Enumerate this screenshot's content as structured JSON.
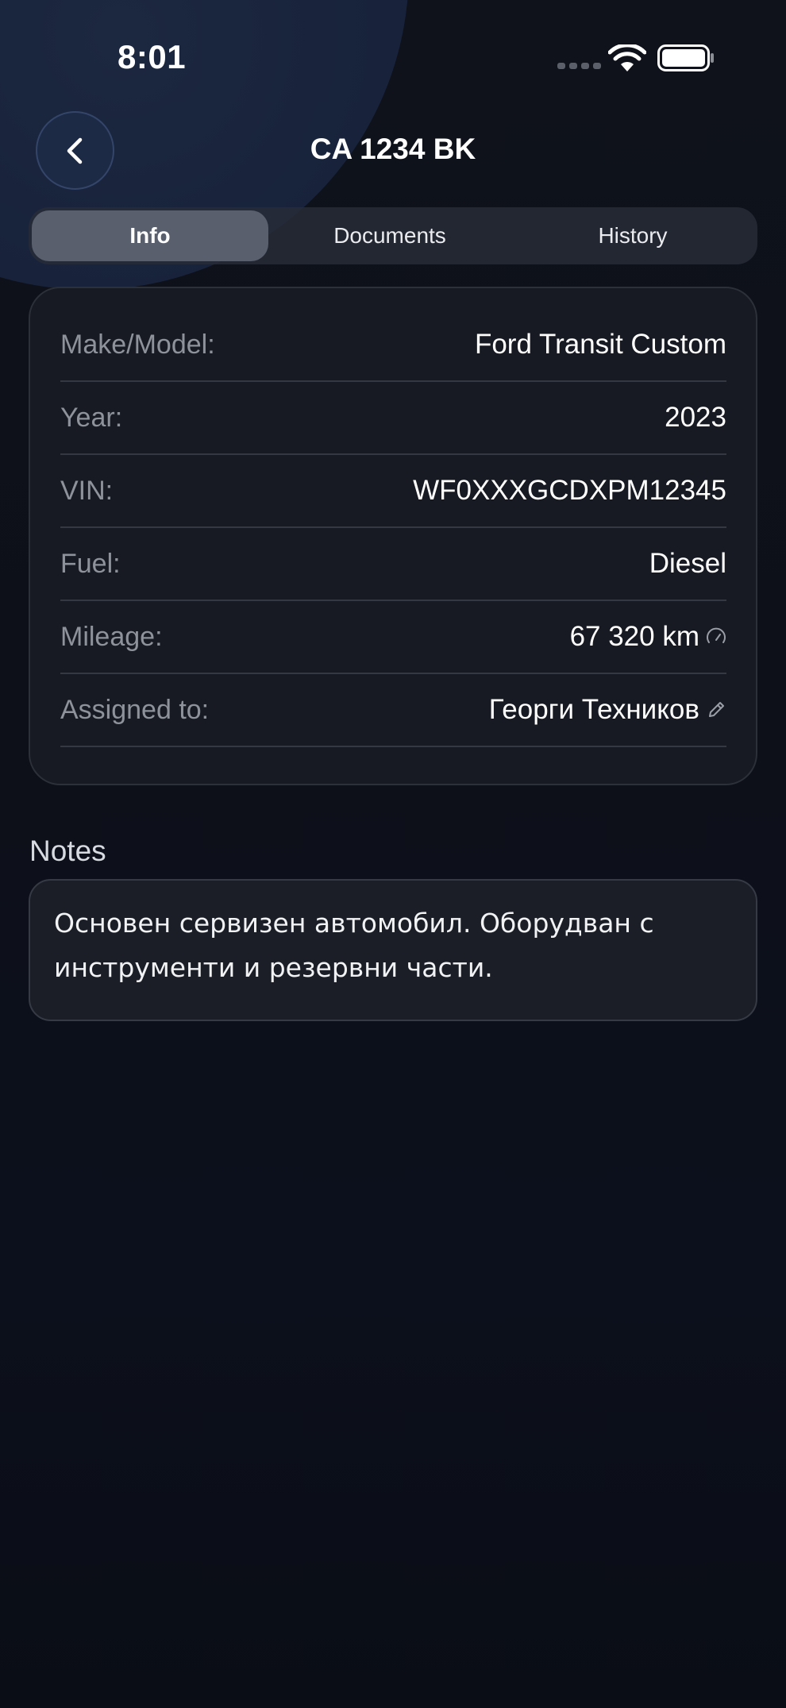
{
  "status_bar": {
    "time": "8:01"
  },
  "header": {
    "title": "CA 1234 BK",
    "back_icon": "chevron-left-icon"
  },
  "tabs": [
    {
      "label": "Info",
      "active": true
    },
    {
      "label": "Documents",
      "active": false
    },
    {
      "label": "History",
      "active": false
    }
  ],
  "vehicle_info": {
    "rows": [
      {
        "label": "Make/Model:",
        "value": "Ford Transit Custom"
      },
      {
        "label": "Year:",
        "value": "2023"
      },
      {
        "label": "VIN:",
        "value": "WF0XXXGCDXPM12345"
      },
      {
        "label": "Fuel:",
        "value": "Diesel"
      },
      {
        "label": "Mileage:",
        "value": "67 320 km",
        "icon": "speedometer-icon"
      },
      {
        "label": "Assigned to:",
        "value": "Георги Техников",
        "icon": "pencil-icon"
      }
    ]
  },
  "notes": {
    "heading": "Notes",
    "text": "Основен сервизен автомобил. Оборудван с инструменти и резервни части."
  },
  "colors": {
    "background": "#0d1019",
    "card": "#171a22",
    "active_tab": "#5a5f6e",
    "back_button": "#1d2a45"
  }
}
